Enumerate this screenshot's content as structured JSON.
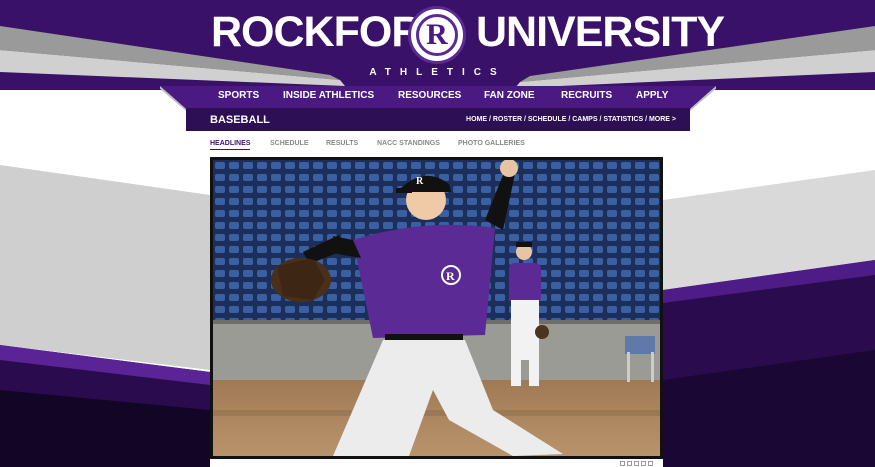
{
  "header": {
    "title_left": "ROCKFORD",
    "title_right": "UNIVERSITY",
    "logo_letter": "R",
    "subtitle": "ATHLETICS"
  },
  "nav": {
    "items": [
      {
        "label": "SPORTS"
      },
      {
        "label": "INSIDE ATHLETICS"
      },
      {
        "label": "RESOURCES"
      },
      {
        "label": "FAN ZONE"
      },
      {
        "label": "RECRUITS"
      },
      {
        "label": "APPLY"
      }
    ]
  },
  "subnav": {
    "sport": "BASEBALL",
    "quick_links": "HOME / ROSTER / SCHEDULE / CAMPS / STATISTICS / MORE >"
  },
  "tabs": [
    {
      "label": "HEADLINES"
    },
    {
      "label": "SCHEDULE"
    },
    {
      "label": "RESULTS"
    },
    {
      "label": "NACC STANDINGS"
    },
    {
      "label": "PHOTO GALLERIES"
    }
  ],
  "photo": {
    "jersey_letter": "R"
  },
  "colors": {
    "brand_purple": "#4a1a82",
    "dark_purple": "#2d0f55",
    "accent_gray": "#bdbdbd"
  }
}
